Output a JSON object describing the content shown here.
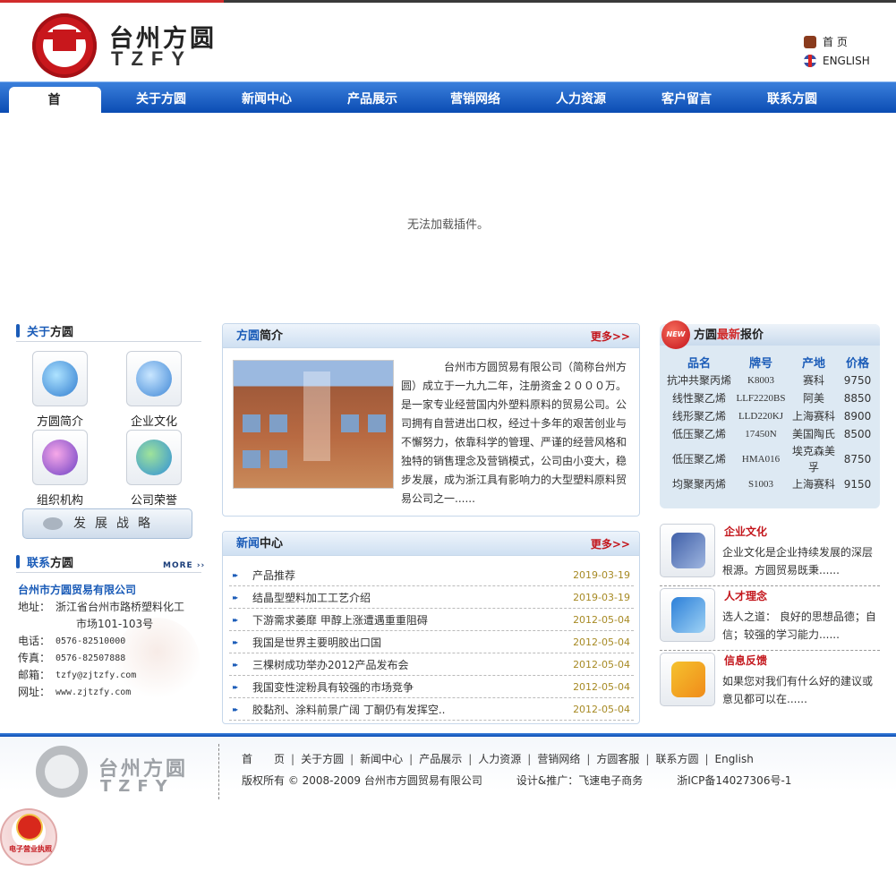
{
  "header": {
    "logo_cn": "台州方圆",
    "logo_en": "TZFY",
    "home_link": "首 页",
    "english_link": "ENGLISH"
  },
  "nav": {
    "items": [
      "首页",
      "关于方圆",
      "新闻中心",
      "产品展示",
      "营销网络",
      "人力资源",
      "客户留言",
      "联系方圆"
    ]
  },
  "banner": {
    "message": "无法加载插件。"
  },
  "about": {
    "title_blue": "关于",
    "title_rest": "方圆",
    "items": [
      "方圆简介",
      "企业文化",
      "组织机构",
      "公司荣誉"
    ],
    "strategy_button": "发展战略"
  },
  "contact": {
    "title_blue": "联系",
    "title_rest": "方圆",
    "more": "MORE",
    "company": "台州市方圆贸易有限公司",
    "address_label": "地址：",
    "address_line1": "浙江省台州市路桥塑料化工",
    "address_line2": "市场101-103号",
    "phone_label": "电话：",
    "phone": "0576-82510000",
    "fax_label": "传真：",
    "fax": "0576-82507888",
    "email_label": "邮箱：",
    "email": "tzfy@zjtzfy.com",
    "web_label": "网址：",
    "web": "www.zjtzfy.com"
  },
  "intro": {
    "title_blue": "方圆",
    "title_rest": "简介",
    "more": "更多>>",
    "text": "台州市方圆贸易有限公司（简称台州方圆）成立于一九九二年，注册资金２０００万。是一家专业经营国内外塑料原料的贸易公司。公司拥有自营进出口权，经过十多年的艰苦创业与不懈努力，依靠科学的管理、严谨的经营风格和独特的销售理念及营销模式，公司由小变大，稳步发展，成为浙江具有影响力的大型塑料原料贸易公司之一......"
  },
  "news": {
    "title_blue": "新闻",
    "title_rest": "中心",
    "more": "更多>>",
    "items": [
      {
        "title": "产品推荐",
        "date": "2019-03-19"
      },
      {
        "title": "结晶型塑料加工工艺介绍",
        "date": "2019-03-19"
      },
      {
        "title": "下游需求萎靡 甲醇上涨遭遇重重阻碍",
        "date": "2012-05-04"
      },
      {
        "title": "我国是世界主要明胶出口国",
        "date": "2012-05-04"
      },
      {
        "title": "三棵树成功举办2012产品发布会",
        "date": "2012-05-04"
      },
      {
        "title": "我国变性淀粉具有较强的市场竞争",
        "date": "2012-05-04"
      },
      {
        "title": "胶黏剂、涂料前景广阔 丁酮仍有发挥空..",
        "date": "2012-05-04"
      }
    ]
  },
  "prices": {
    "badge": "NEW",
    "title_a": "方圆",
    "title_red": "最新",
    "title_b": "报价",
    "headers": [
      "品名",
      "牌号",
      "产地",
      "价格"
    ],
    "rows": [
      [
        "抗冲共聚丙烯",
        "K8003",
        "赛科",
        "9750"
      ],
      [
        "线性聚乙烯",
        "LLF2220BS",
        "阿美",
        "8850"
      ],
      [
        "线形聚乙烯",
        "LLD220KJ",
        "上海赛科",
        "8900"
      ],
      [
        "低压聚乙烯",
        "17450N",
        "美国陶氏",
        "8500"
      ],
      [
        "低压聚乙烯",
        "HMA016",
        "埃克森美孚",
        "8750"
      ],
      [
        "均聚聚丙烯",
        "S1003",
        "上海赛科",
        "9150"
      ]
    ]
  },
  "right_blocks": [
    {
      "title": "企业文化",
      "text": "企业文化是企业持续发展的深层根源。方圆贸易既秉......"
    },
    {
      "title": "人才理念",
      "text": "选人之道： 良好的思想品德；自信；较强的学习能力......"
    },
    {
      "title": "信息反馈",
      "text": "如果您对我们有什么好的建议或意见都可以在......"
    }
  ],
  "footer": {
    "logo_cn": "台州方圆",
    "logo_en": "TZFY",
    "links": [
      "首　　页",
      "关于方圆",
      "新闻中心",
      "产品展示",
      "人力资源",
      "营销网络",
      "方圆客服",
      "联系方圆",
      "English"
    ],
    "copyright": "版权所有 © 2008-2009 台州市方圆贸易有限公司",
    "design": "设计&推广：飞速电子商务",
    "icp": "浙ICP备14027306号-1",
    "license_label": "电子营业执照"
  },
  "colors": {
    "nav_blue": "#0b4cb3",
    "accent_red": "#c3161c",
    "link_blue": "#1b5cb8"
  }
}
